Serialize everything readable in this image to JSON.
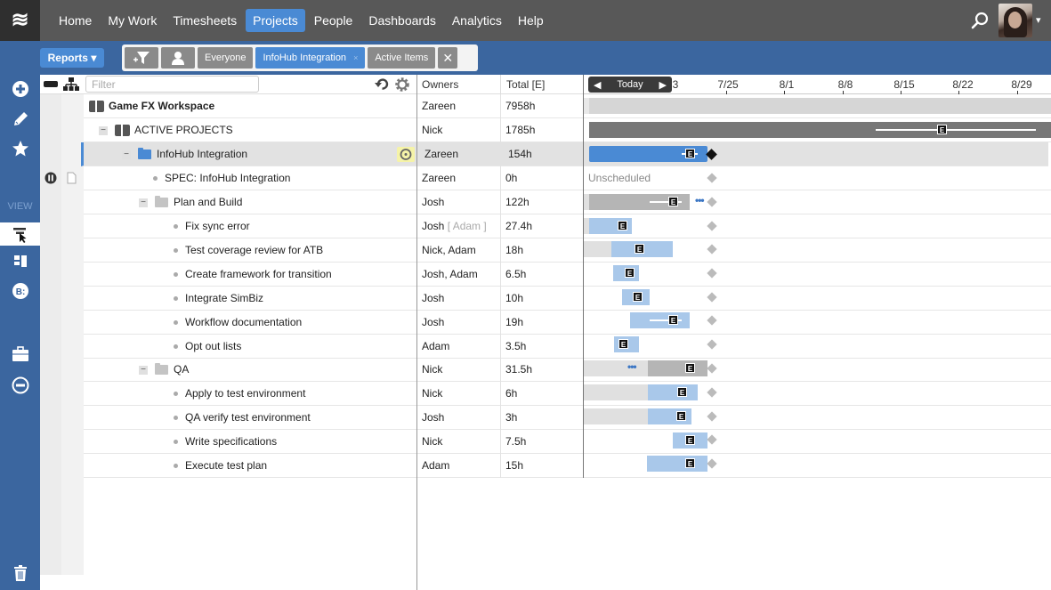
{
  "nav": {
    "logo": "≋",
    "items": [
      {
        "label": "Home",
        "active": false
      },
      {
        "label": "My Work",
        "active": false
      },
      {
        "label": "Timesheets",
        "active": false
      },
      {
        "label": "Projects",
        "active": true
      },
      {
        "label": "People",
        "active": false
      },
      {
        "label": "Dashboards",
        "active": false
      },
      {
        "label": "Analytics",
        "active": false
      },
      {
        "label": "Help",
        "active": false
      }
    ],
    "search_icon": "search-icon",
    "avatar_caret": "▾"
  },
  "subbar": {
    "reports_label": "Reports ▾",
    "filters": {
      "everyone": "Everyone",
      "project": "InfoHub Integration",
      "project_remove": "×",
      "active": "Active Items",
      "clear": "✕"
    }
  },
  "sidebar": {
    "view_label": "VIEW",
    "icons": [
      "add-icon",
      "edit-icon",
      "star-icon",
      "gantt-view-icon",
      "board-view-icon",
      "bookings-icon",
      "briefcase-icon",
      "minus-circle-icon",
      "trash-icon"
    ]
  },
  "tree": {
    "filter_placeholder": "Filter",
    "columns": {
      "owners": "Owners",
      "total": "Total [E]"
    },
    "rows": [
      {
        "name": "Game FX Workspace",
        "owner": "Zareen",
        "owner_extra": "",
        "total": "7958h"
      },
      {
        "name": "ACTIVE PROJECTS",
        "owner": "Nick",
        "owner_extra": "",
        "total": "1785h"
      },
      {
        "name": "InfoHub Integration",
        "owner": "Zareen",
        "owner_extra": "",
        "total": "154h"
      },
      {
        "name": "SPEC: InfoHub Integration",
        "owner": "Zareen",
        "owner_extra": "",
        "total": "0h"
      },
      {
        "name": "Plan and Build",
        "owner": "Josh",
        "owner_extra": "",
        "total": "122h"
      },
      {
        "name": "Fix sync error",
        "owner": "Josh",
        "owner_extra": "[ Adam ]",
        "total": "27.4h"
      },
      {
        "name": "Test coverage review for ATB",
        "owner": "Nick, Adam",
        "owner_extra": "",
        "total": "18h"
      },
      {
        "name": "Create framework for transition",
        "owner": "Josh, Adam",
        "owner_extra": "",
        "total": "6.5h"
      },
      {
        "name": "Integrate SimBiz",
        "owner": "Josh",
        "owner_extra": "",
        "total": "10h"
      },
      {
        "name": "Workflow documentation",
        "owner": "Josh",
        "owner_extra": "",
        "total": "19h"
      },
      {
        "name": "Opt out lists",
        "owner": "Adam",
        "owner_extra": "",
        "total": "3.5h"
      },
      {
        "name": "QA",
        "owner": "Nick",
        "owner_extra": "",
        "total": "31.5h"
      },
      {
        "name": "Apply to test environment",
        "owner": "Nick",
        "owner_extra": "",
        "total": "6h"
      },
      {
        "name": "QA verify test environment",
        "owner": "Josh",
        "owner_extra": "",
        "total": "3h"
      },
      {
        "name": "Write specifications",
        "owner": "Nick",
        "owner_extra": "",
        "total": "7.5h"
      },
      {
        "name": "Execute test plan",
        "owner": "Adam",
        "owner_extra": "",
        "total": "15h"
      }
    ]
  },
  "gantt": {
    "today_label": "Today",
    "prev": "◀",
    "next": "▶",
    "partial_tick": "3",
    "ticks": [
      "7/25",
      "8/1",
      "8/8",
      "8/15",
      "8/22",
      "8/29"
    ],
    "unscheduled_label": "Unscheduled",
    "marker_label": "E"
  },
  "colors": {
    "nav_bg": "#585858",
    "brand_blue": "#3b669f",
    "accent_blue": "#4a8ad4",
    "bar_light_blue": "#a9c8ea",
    "bar_gray": "#b5b5b5",
    "bar_dark_gray": "#777777"
  }
}
